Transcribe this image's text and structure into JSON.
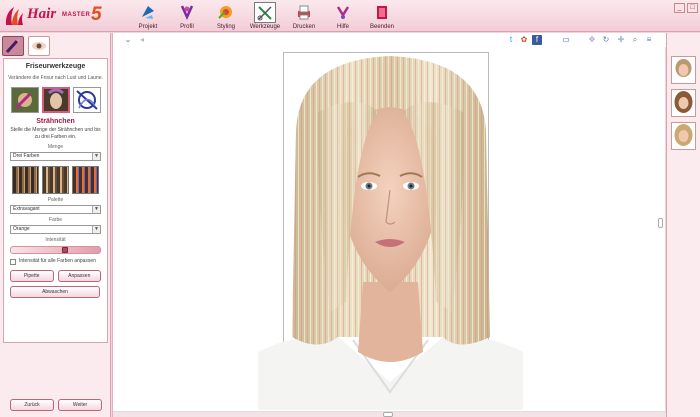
{
  "app": {
    "logo_hair": "Hair",
    "logo_master": "MASTER",
    "logo_version": "5"
  },
  "toolbar": {
    "items": [
      {
        "label": "Projekt",
        "icon": "project-icon"
      },
      {
        "label": "Profil",
        "icon": "profile-icon"
      },
      {
        "label": "Styling",
        "icon": "styling-icon"
      },
      {
        "label": "Werkzeuge",
        "icon": "tools-icon"
      },
      {
        "label": "Drucken",
        "icon": "print-icon"
      },
      {
        "label": "Hilfe",
        "icon": "help-icon"
      },
      {
        "label": "Beenden",
        "icon": "exit-icon"
      }
    ],
    "active": "Werkzeuge"
  },
  "window_buttons": [
    "_",
    "□"
  ],
  "panel": {
    "title": "Friseurwerkzeuge",
    "subtitle": "Verändere die Frisur nach Lust und Laune.",
    "section_title": "Strähnchen",
    "section_desc": "Stelle die Menge der Strähnchen und bis zu drei Farben ein.",
    "menge_label": "Menge",
    "menge_value": "Drei Farben",
    "palette_label": "Palette",
    "palette_value": "Extravagant",
    "farbe_label": "Farbe",
    "farbe_value": "Orange",
    "intensity_label": "Intensität",
    "intensity_level": 0.62,
    "checkbox_label": "Intensität für alle Farben anpassen",
    "checkbox_checked": false,
    "pipette_label": "Pipette",
    "anpassen_label": "Anpassen",
    "abwaschen_label": "Abwaschen"
  },
  "nav": {
    "back_label": "Zurück",
    "next_label": "Weiter"
  },
  "colors": {
    "accent": "#c4124a",
    "panel_border": "#d9a3b2",
    "background": "#f4d4dc"
  }
}
